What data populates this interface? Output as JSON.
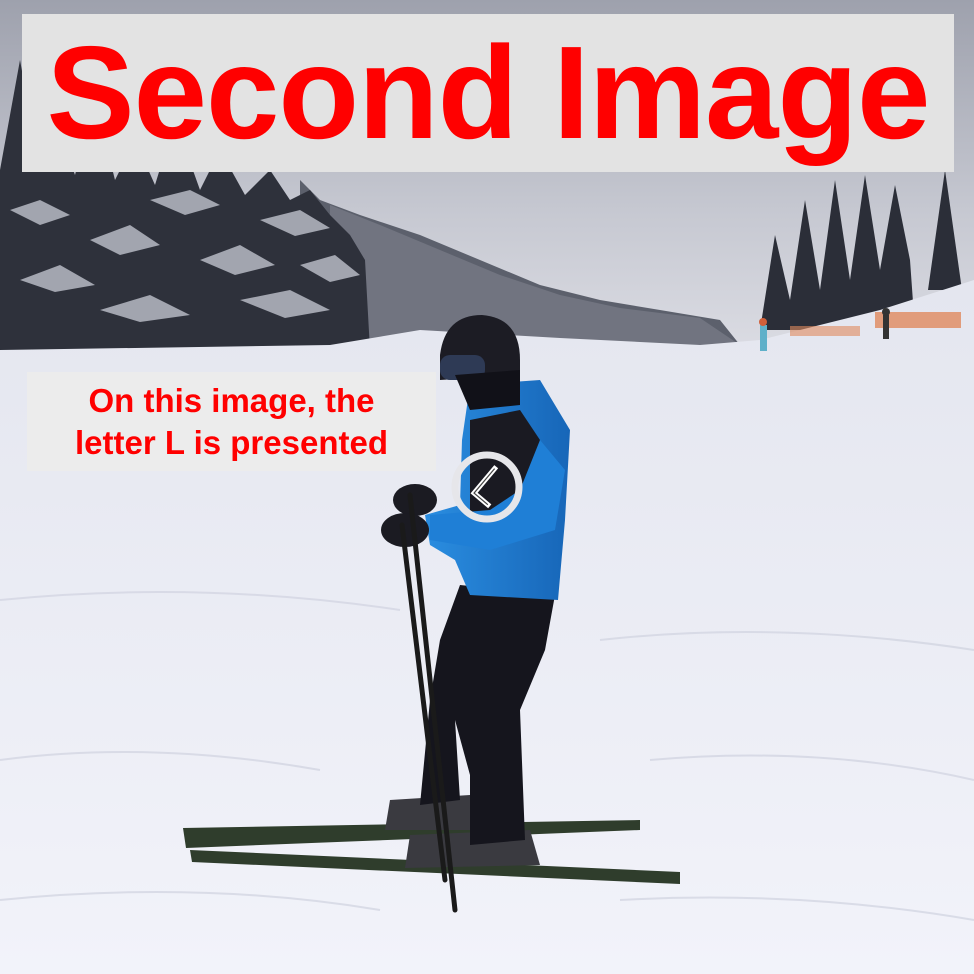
{
  "title": {
    "text": "Second Image",
    "color": "#ff0000"
  },
  "caption": {
    "line1": "On this image, the",
    "line2": "letter L is presented",
    "color": "#ff0000"
  },
  "marker": {
    "symbol": "letter-L-glyph",
    "shape": "circle"
  },
  "colors": {
    "sky": "#b9bbc6",
    "snow": "#eceff8",
    "jacket": "#1f7fd6",
    "pants": "#15151d",
    "trees": "#2a2d36"
  }
}
